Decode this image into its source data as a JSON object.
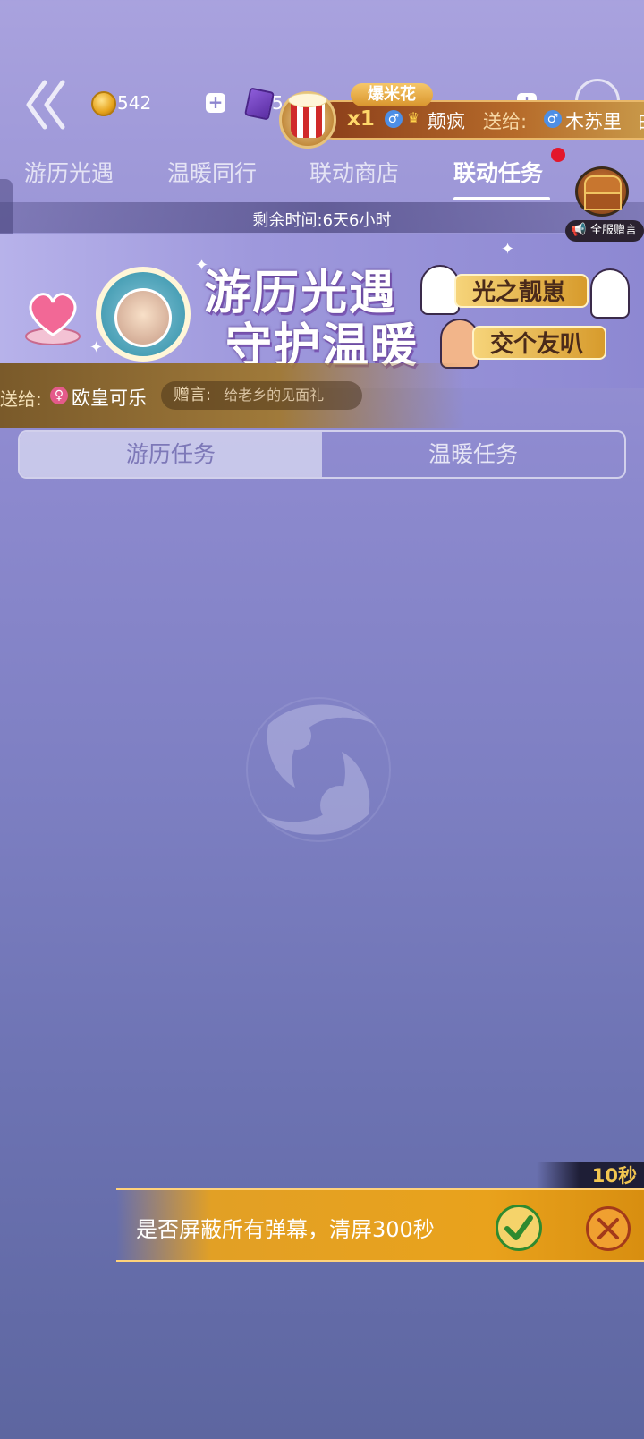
{
  "top_bar": {
    "coin_count": "542",
    "ticket_count": "5"
  },
  "gift_banner": {
    "gift_name": "爆米花",
    "quantity": "x1",
    "sender": "颠疯",
    "send_to_label": "送给:",
    "receiver": "木苏里",
    "receiver_tail": "白"
  },
  "tabs": [
    {
      "label": "游历光遇"
    },
    {
      "label": "温暖同行"
    },
    {
      "label": "联动商店"
    },
    {
      "label": "联动任务"
    }
  ],
  "broadcast_label": "全服赠言",
  "remaining_time": "剩余时间:6天6小时",
  "event_banner": {
    "title_line1": "游历光遇",
    "title_line2": "守护温暖",
    "tag1": "光之靓崽",
    "tag2": "交个友叭"
  },
  "gift_bar2": {
    "send_to_label": "送给:",
    "receiver": "欧皇可乐",
    "message_label": "赠言:",
    "message_text": "给老乡的见面礼"
  },
  "segment": {
    "left": "游历任务",
    "right": "温暖任务"
  },
  "prompt": {
    "countdown": "10秒",
    "text": "是否屏蔽所有弹幕，清屏300秒"
  },
  "colors": {
    "accent_orange": "#e2a025",
    "badge_red": "#e3172b"
  }
}
